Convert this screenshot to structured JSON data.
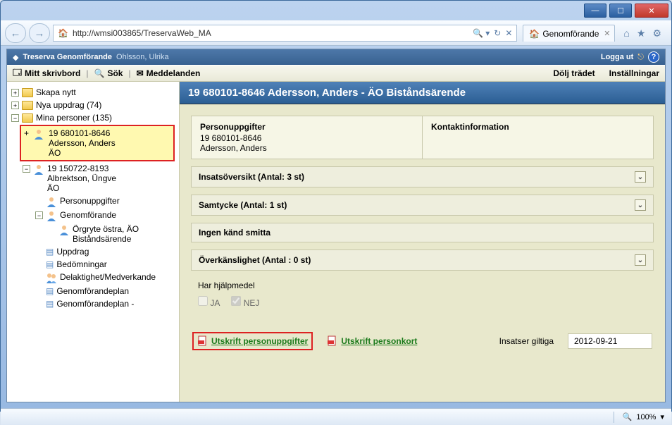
{
  "browser": {
    "url": "http://wmsi003865/TreservaWeb_MA",
    "tab_title": "Genomförande",
    "zoom": "100%"
  },
  "app": {
    "title": "Treserva Genomförande",
    "user": "Ohlsson, Ulrika",
    "logout": "Logga ut"
  },
  "toolbar": {
    "desktop": "Mitt skrivbord",
    "search": "Sök",
    "messages": "Meddelanden",
    "hide_tree": "Dölj trädet",
    "settings": "Inställningar"
  },
  "tree": {
    "create_new": "Skapa nytt",
    "new_assignments": "Nya uppdrag (74)",
    "my_persons": "Mina personer (135)",
    "person1_id": "19 680101-8646",
    "person1_name": "Adersson, Anders",
    "person1_unit": "ÄO",
    "person2_id": "19 150722-8193",
    "person2_name": "Albrektson, Üngve",
    "person2_unit": "ÄO",
    "personuppgifter": "Personuppgifter",
    "genomforande": "Genomförande",
    "orgryte": "Örgryte östra, ÄO Biståndsärende",
    "uppdrag": "Uppdrag",
    "bedomningar": "Bedömningar",
    "delaktighet": "Delaktighet/Medverkande",
    "plan": "Genomförandeplan",
    "plan2": "Genomförandeplan -"
  },
  "main": {
    "title": "19 680101-8646 Adersson, Anders - ÄO Biståndsärende",
    "personuppgifter_h": "Personuppgifter",
    "person_id": "19 680101-8646",
    "person_name": "Adersson, Anders",
    "kontakt_h": "Kontaktinformation",
    "acc_insats": "Insatsöversikt (Antal: 3 st)",
    "acc_samtycke": "Samtycke (Antal: 1 st)",
    "acc_smitta": "Ingen känd smitta",
    "acc_overk": "Överkänslighet (Antal : 0 st)",
    "aid_label": "Har hjälpmedel",
    "aid_yes": "JA",
    "aid_no": "NEJ",
    "print_person": "Utskrift personuppgifter",
    "print_card": "Utskrift personkort",
    "valid_label": "Insatser giltiga",
    "valid_date": "2012-09-21"
  }
}
